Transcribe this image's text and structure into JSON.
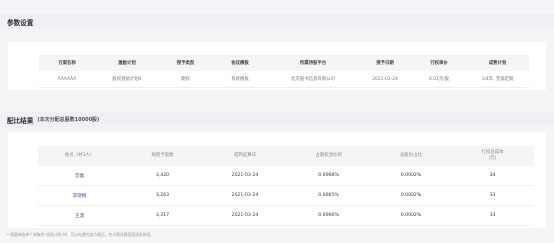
{
  "params": {
    "section_title": "参数设置",
    "columns": [
      "方案名称",
      "激励计划",
      "授予类型",
      "协议模板",
      "所属持股平台",
      "授予日期",
      "行权单价",
      "成熟计划"
    ],
    "row": [
      "AAAAAA",
      "股权激励计划4",
      "期权",
      "系统模板",
      "北京股书信息有限公司",
      "2021-03-24",
      "0.01元/股",
      "1/4年, 无锁定期"
    ]
  },
  "allocation": {
    "section_title": "配比结果",
    "section_subtitle": "(本次分配总股数10000股)",
    "columns": [
      "姓名（共3人）",
      "拟授予股数",
      "成熟起算日",
      "占期权池比例",
      "总股份占比",
      "行权总成本\n(元)"
    ],
    "rows": [
      {
        "name": "宫徽",
        "shares": "3,420",
        "start_date": "2021-03-24",
        "pool_ratio": "0.0068%",
        "total_ratio": "0.0002%",
        "cost": "34"
      },
      {
        "name": "李晓桐",
        "shares": "3,263",
        "start_date": "2021-03-24",
        "pool_ratio": "0.0065%",
        "total_ratio": "0.0002%",
        "cost": "33"
      },
      {
        "name": "王漫",
        "shares": "3,317",
        "start_date": "2021-03-24",
        "pool_ratio": "0.0066%",
        "total_ratio": "0.0002%",
        "cost": "33"
      }
    ]
  },
  "footnote": "* 需要修改单个参数的\"成熟计划\"时，可以在建完该方案后，在方案详情里面逐条修改。"
}
